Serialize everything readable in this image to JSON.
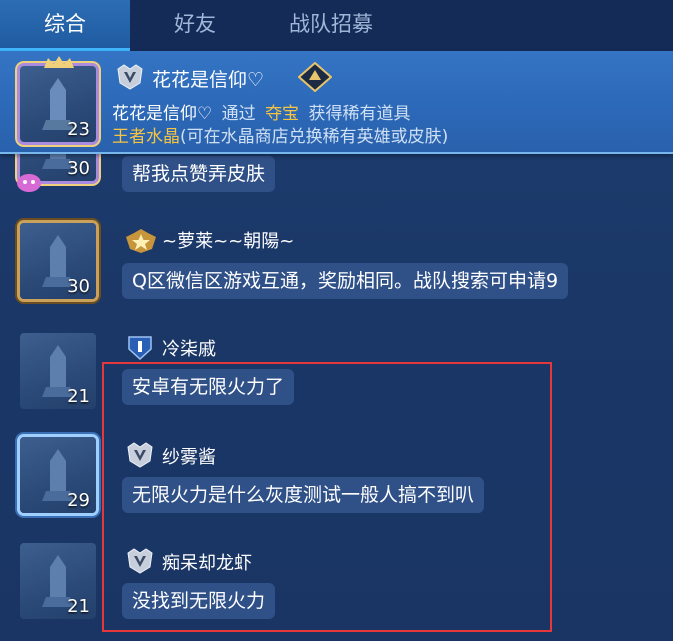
{
  "tabs": [
    {
      "label": "综合"
    },
    {
      "label": "好友"
    },
    {
      "label": "战队招募"
    }
  ],
  "system_message": {
    "sender": "花花是信仰♡",
    "line1": {
      "name": "花花是信仰♡",
      "text": "通过",
      "source": "夺宝",
      "result": "获得稀有道具"
    },
    "line2": {
      "item": "王者水晶",
      "note": "(可在水晶商店兑换稀有英雄或皮肤)"
    },
    "avatar_level": "23"
  },
  "messages": [
    {
      "name": "",
      "text": "帮我点赞弄皮肤",
      "level": "30"
    },
    {
      "name": "~萝莱~~朝陽~",
      "text": "Q区微信区游戏互通，奖励相同。战队搜索可申请9",
      "level": "30"
    },
    {
      "name": "冷柒戚",
      "text": "安卓有无限火力了",
      "level": "21"
    },
    {
      "name": "纱雾酱",
      "text": "无限火力是什么灰度测试一般人搞不到叭",
      "level": "29"
    },
    {
      "name": "痴呆却龙虾",
      "text": "没找到无限火力",
      "level": "21"
    }
  ],
  "colors": {
    "highlight_text": "#f5c542",
    "highlight_box": "#e5383c",
    "bubble": "#2f5188"
  },
  "icons": {
    "rank_v": "v-rank-badge-icon",
    "rank_star": "star-rank-badge-icon",
    "rank_i": "bronze-rank-badge-icon",
    "guild": "guild-emblem-icon"
  }
}
